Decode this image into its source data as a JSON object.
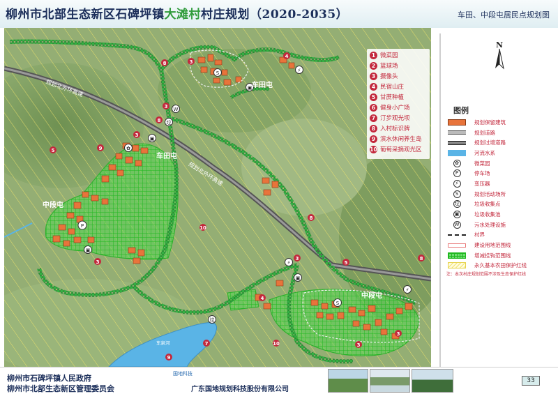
{
  "header": {
    "title_part1": "柳州市北部生态新区石碑坪镇",
    "title_highlight": "大滩村",
    "title_part2": "村庄规划（2020-2035）",
    "subtitle": "车田、中段屯居民点规划图"
  },
  "map": {
    "labels": {
      "village_chetian": "车田屯",
      "village_chetian_2": "车田屯",
      "village_zhongduan": "中段屯",
      "village_zhongduan_2": "中段屯",
      "road_label_1": "规划北外环高速",
      "road_label_2": "规划北外环高速",
      "river_label": "东泉河"
    },
    "poi_list": [
      {
        "num": "1",
        "label": "微菜园"
      },
      {
        "num": "2",
        "label": "篮球场"
      },
      {
        "num": "3",
        "label": "摄像头"
      },
      {
        "num": "4",
        "label": "民宿山庄"
      },
      {
        "num": "5",
        "label": "甘蔗种植"
      },
      {
        "num": "6",
        "label": "健身小广场"
      },
      {
        "num": "7",
        "label": "汀步观光坝"
      },
      {
        "num": "8",
        "label": "入村标识牌"
      },
      {
        "num": "9",
        "label": "滨水休闲养生岛"
      },
      {
        "num": "10",
        "label": "葡萄采摘观光区"
      }
    ]
  },
  "legend": {
    "north": "N",
    "title": "图例",
    "items": [
      {
        "label": "规划保留建筑",
        "symbol": "building"
      },
      {
        "label": "规划道路",
        "symbol": "road"
      },
      {
        "label": "规划过境道路",
        "symbol": "transit-road"
      },
      {
        "label": "河流水系",
        "symbol": "river"
      },
      {
        "label": "微菜园",
        "symbol": "garden-icon"
      },
      {
        "label": "停车场",
        "symbol": "parking-icon"
      },
      {
        "label": "变压器",
        "symbol": "transformer-icon"
      },
      {
        "label": "规划活动场所",
        "symbol": "activity-icon"
      },
      {
        "label": "垃圾收集点",
        "symbol": "trash-point-icon"
      },
      {
        "label": "垃圾收集池",
        "symbol": "trash-pool-icon"
      },
      {
        "label": "污水处理设施",
        "symbol": "sewage-icon"
      },
      {
        "label": "村界",
        "symbol": "village-boundary"
      },
      {
        "label": "建设用地范围线",
        "symbol": "construction-line"
      },
      {
        "label": "增减挂钩范围线",
        "symbol": "green-grid"
      },
      {
        "label": "永久基本农田保护红线",
        "symbol": "farmland-redline"
      }
    ],
    "note": "注：本次村庄规划范围不涉及生态保护红线"
  },
  "footer": {
    "gov1": "柳州市石碑坪镇人民政府",
    "gov2": "柳州市北部生态新区管理委员会",
    "company": "广东国地规划科技股份有限公司",
    "logo_text": "国地科技",
    "page": "33"
  },
  "colors": {
    "title_blue": "#1b2e5a",
    "highlight_green": "#2f9b3a",
    "poi_red": "#c3283c",
    "building_orange": "#e8743b",
    "grid_green": "#33cc33",
    "river_blue": "#5ab4e6",
    "tree_green": "#2faa3a"
  }
}
